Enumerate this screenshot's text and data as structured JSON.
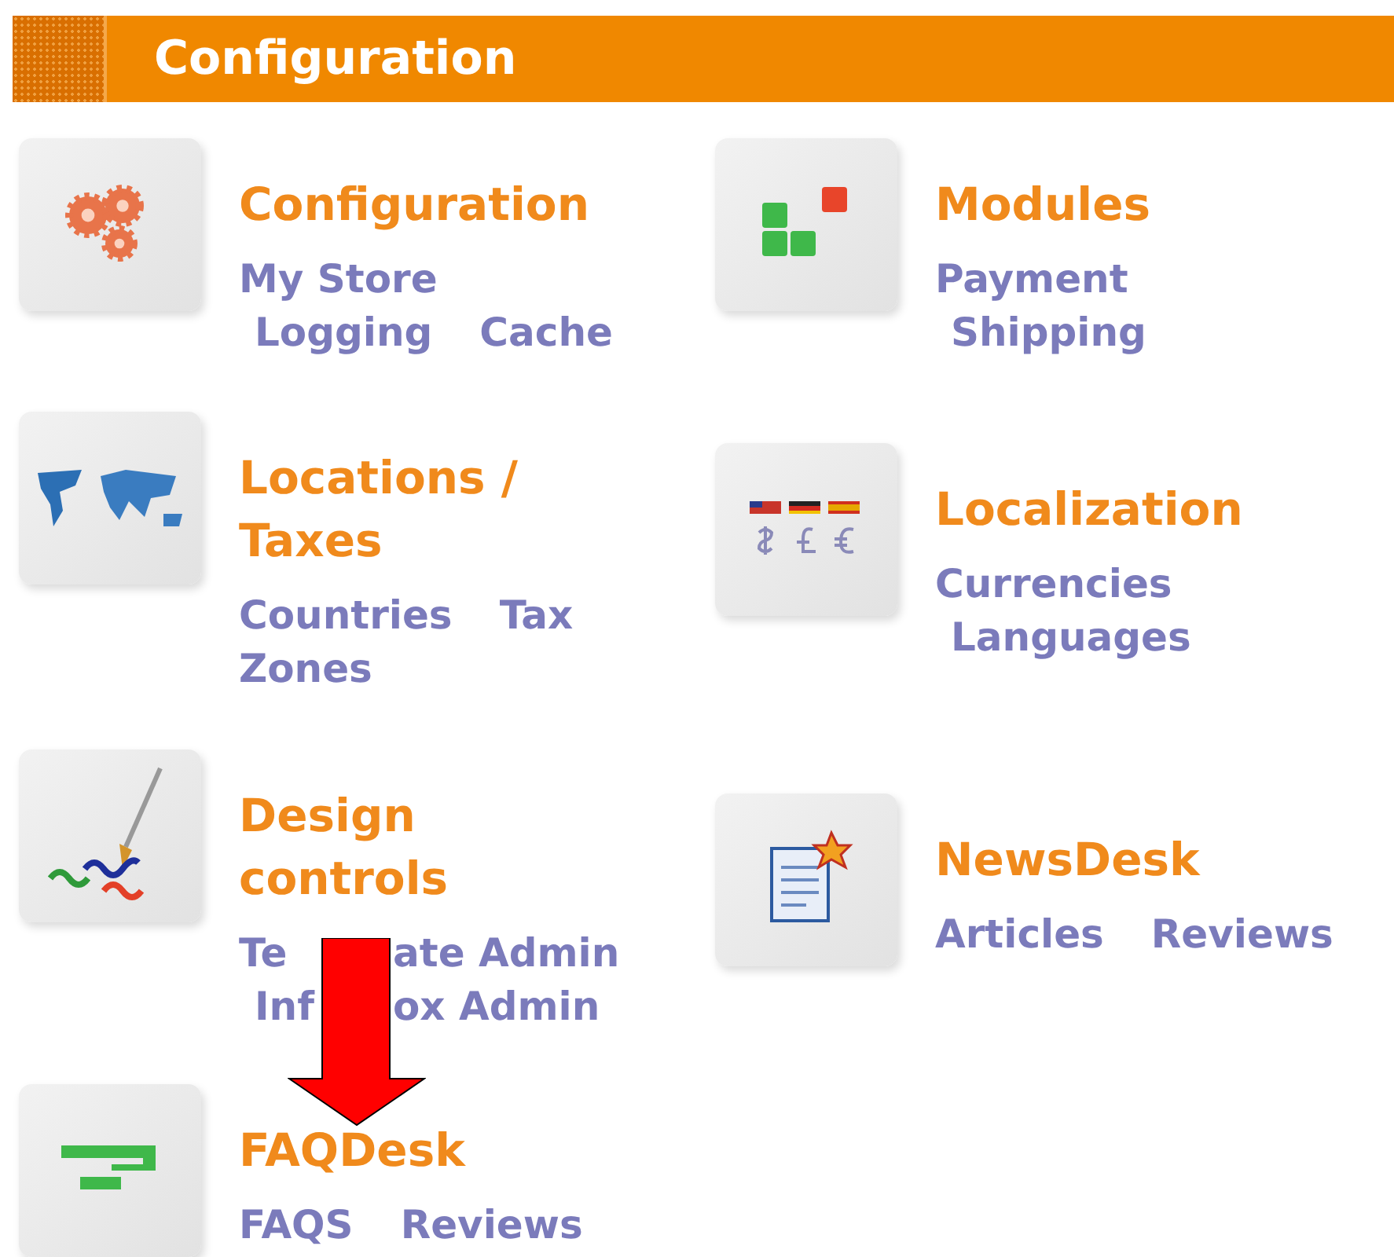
{
  "header": {
    "title": "Configuration"
  },
  "sections": [
    {
      "title_lines": [
        "Configuration"
      ],
      "link_lines": [
        [
          "My Store"
        ],
        [
          "Logging",
          "Cache"
        ]
      ]
    },
    {
      "title_lines": [
        "Modules"
      ],
      "link_lines": [
        [
          "Payment"
        ],
        [
          "Shipping"
        ]
      ]
    },
    {
      "title_lines": [
        "Locations /",
        "Taxes"
      ],
      "link_lines": [
        [
          "Countries",
          "Tax"
        ],
        [
          "Zones"
        ]
      ]
    },
    {
      "title_lines": [
        "Localization"
      ],
      "link_lines": [
        [
          "Currencies"
        ],
        [
          "Languages"
        ]
      ]
    },
    {
      "title_lines": [
        "Design",
        "controls"
      ],
      "link_lines": [
        [
          [
            "Te",
            "ate Admin"
          ]
        ],
        [
          [
            "Inf",
            "ox Admin"
          ]
        ]
      ]
    },
    {
      "title_lines": [
        "NewsDesk"
      ],
      "link_lines": [
        [
          "Articles",
          "Reviews"
        ]
      ]
    },
    {
      "title_lines": [
        "FAQDesk"
      ],
      "link_lines": [
        [
          "FAQS",
          "Reviews"
        ]
      ]
    }
  ],
  "annotation": {
    "kind": "down-arrow"
  }
}
